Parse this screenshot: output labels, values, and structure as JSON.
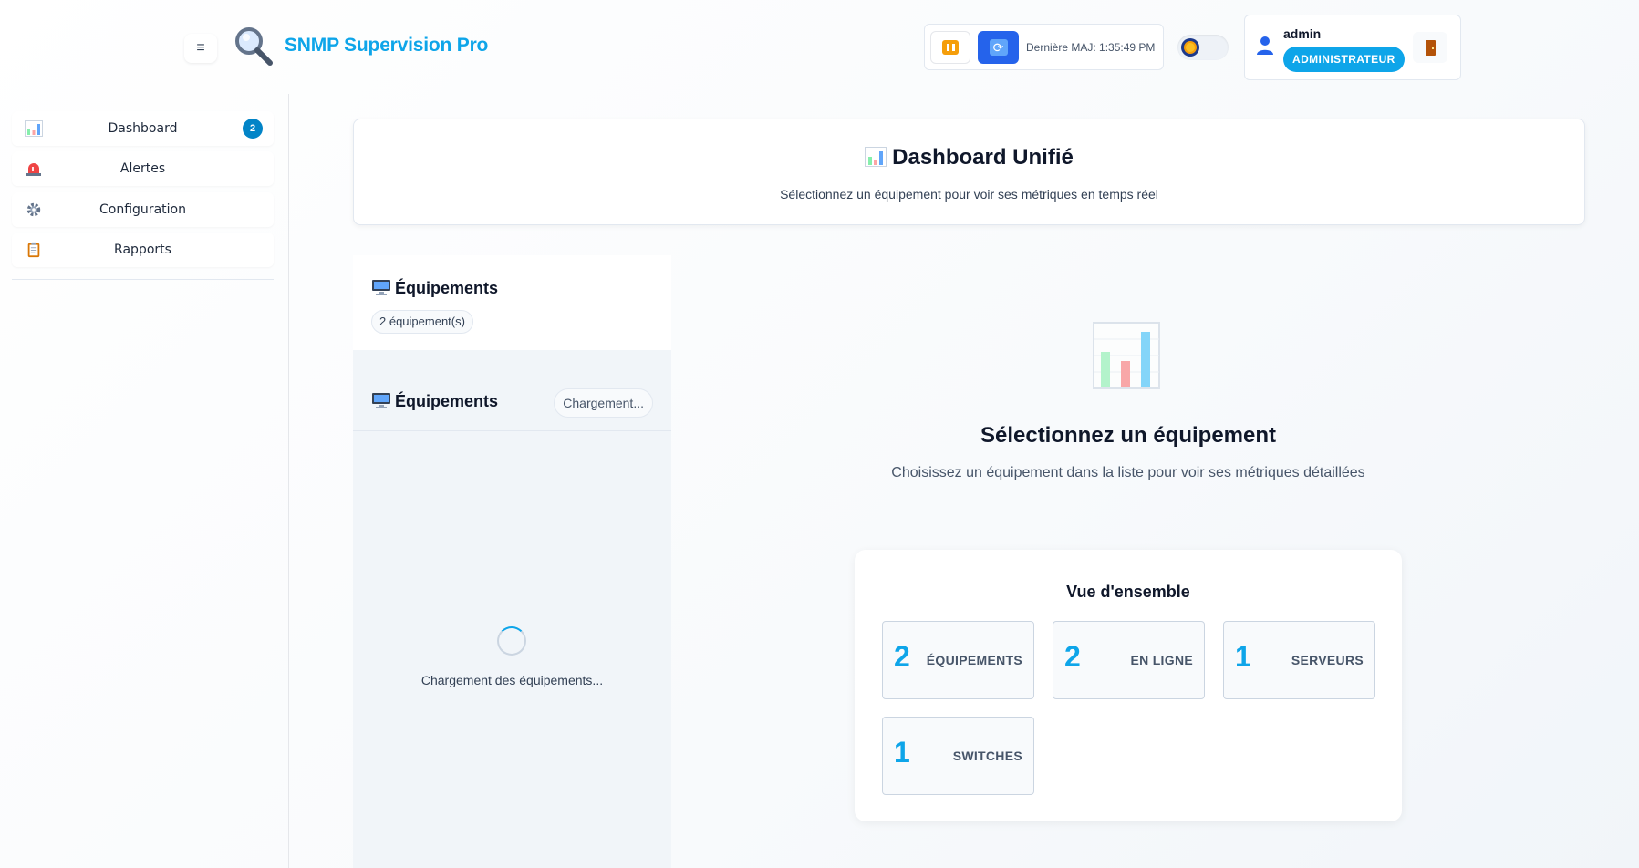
{
  "header": {
    "menu_icon": "hamburger-icon",
    "logo_icon": "magnifier-icon",
    "app_title": "SNMP Supervision Pro",
    "last_update": "Dernière MAJ: 1:35:49 PM",
    "pause_icon": "pause-icon",
    "refresh_icon": "sync-icon",
    "theme_icon": "sun-icon",
    "user": {
      "name": "admin",
      "role": "ADMINISTRATEUR",
      "icon": "user-icon",
      "logout_icon": "door-icon"
    }
  },
  "sidebar": {
    "items": [
      {
        "label": "Dashboard",
        "icon": "bar-chart-icon",
        "badge": "2"
      },
      {
        "label": "Alertes",
        "icon": "siren-icon"
      },
      {
        "label": "Configuration",
        "icon": "gear-icon"
      },
      {
        "label": "Rapports",
        "icon": "clipboard-icon"
      }
    ]
  },
  "hero": {
    "title": "Dashboard Unifié",
    "subtitle": "Sélectionnez un équipement pour voir ses métriques en temps réel"
  },
  "equipment_panel": {
    "title": "Équipements",
    "count": "2 équipement(s)",
    "list_title": "Équipements",
    "loading_pill": "Chargement...",
    "loading_text": "Chargement des équipements..."
  },
  "empty_state": {
    "title": "Sélectionnez un équipement",
    "subtitle": "Choisissez un équipement dans la liste pour voir ses métriques détaillées"
  },
  "overview": {
    "title": "Vue d'ensemble",
    "stats": [
      {
        "value": "2",
        "label": "ÉQUIPEMENTS"
      },
      {
        "value": "2",
        "label": "EN LIGNE"
      },
      {
        "value": "1",
        "label": "SERVEURS"
      },
      {
        "value": "1",
        "label": "SWITCHES"
      }
    ]
  },
  "colors": {
    "accent": "#0ea5e9",
    "primary_button": "#2563eb",
    "warning": "#f59e0b"
  }
}
